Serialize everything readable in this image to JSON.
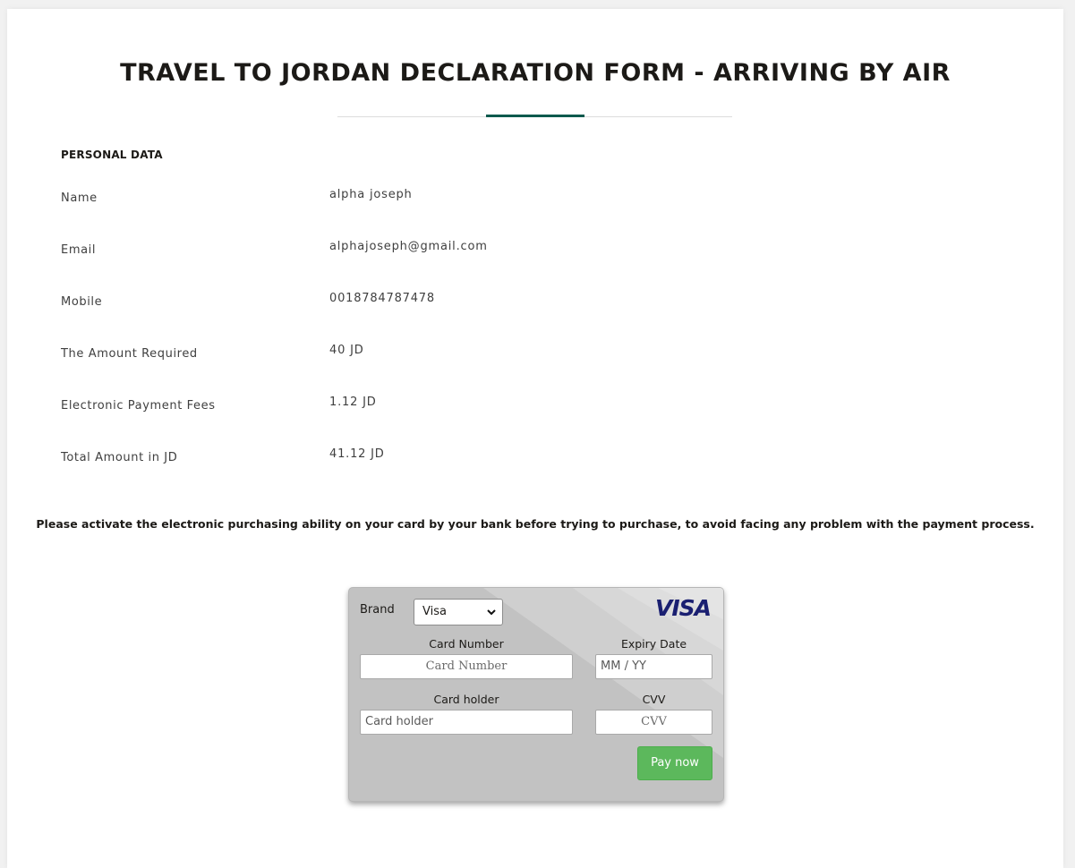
{
  "header": {
    "title": "TRAVEL TO JORDAN DECLARATION FORM - ARRIVING BY AIR",
    "accent_color": "#0b5a4d"
  },
  "personal_data": {
    "heading": "PERSONAL DATA",
    "fields": [
      {
        "label": "Name",
        "value": "alpha joseph"
      },
      {
        "label": "Email",
        "value": "alphajoseph@gmail.com"
      },
      {
        "label": "Mobile",
        "value": "0018784787478"
      },
      {
        "label": "The Amount Required",
        "value": "40 JD"
      },
      {
        "label": "Electronic Payment Fees",
        "value": "1.12 JD"
      },
      {
        "label": "Total Amount in JD",
        "value": "41.12 JD"
      }
    ]
  },
  "notice": "Please activate the electronic purchasing ability on your card by your bank before trying to purchase, to avoid facing any problem with the payment process.",
  "payment_card": {
    "brand_label": "Brand",
    "brand_selected": "Visa",
    "brand_logo_text": "VISA",
    "brand_logo_color": "#1a1f71",
    "card_number_label": "Card Number",
    "card_number_placeholder": "Card Number",
    "expiry_label": "Expiry Date",
    "expiry_placeholder": "MM / YY",
    "card_holder_label": "Card holder",
    "card_holder_placeholder": "Card holder",
    "cvv_label": "CVV",
    "cvv_placeholder": "CVV",
    "pay_button_label": "Pay now",
    "pay_button_color": "#5cb85c"
  }
}
